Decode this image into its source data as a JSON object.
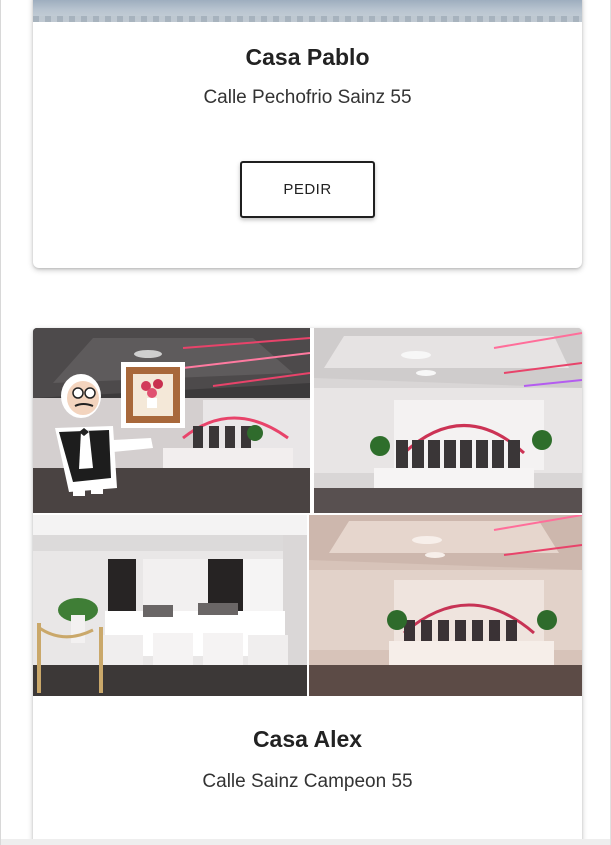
{
  "restaurants": [
    {
      "name": "Casa Pablo",
      "address": "Calle Pechofrio Sainz 55",
      "order_label": "PEDIR"
    },
    {
      "name": "Casa Alex",
      "address": "Calle Sainz Campeon 55"
    }
  ],
  "colors": {
    "accent_pink": "#e8436a",
    "card_border": "#1f1f1f",
    "floor": "#5a4c46"
  },
  "icons": {
    "mascot": "waiter-mascot-icon",
    "frame": "framed-picture-icon"
  }
}
